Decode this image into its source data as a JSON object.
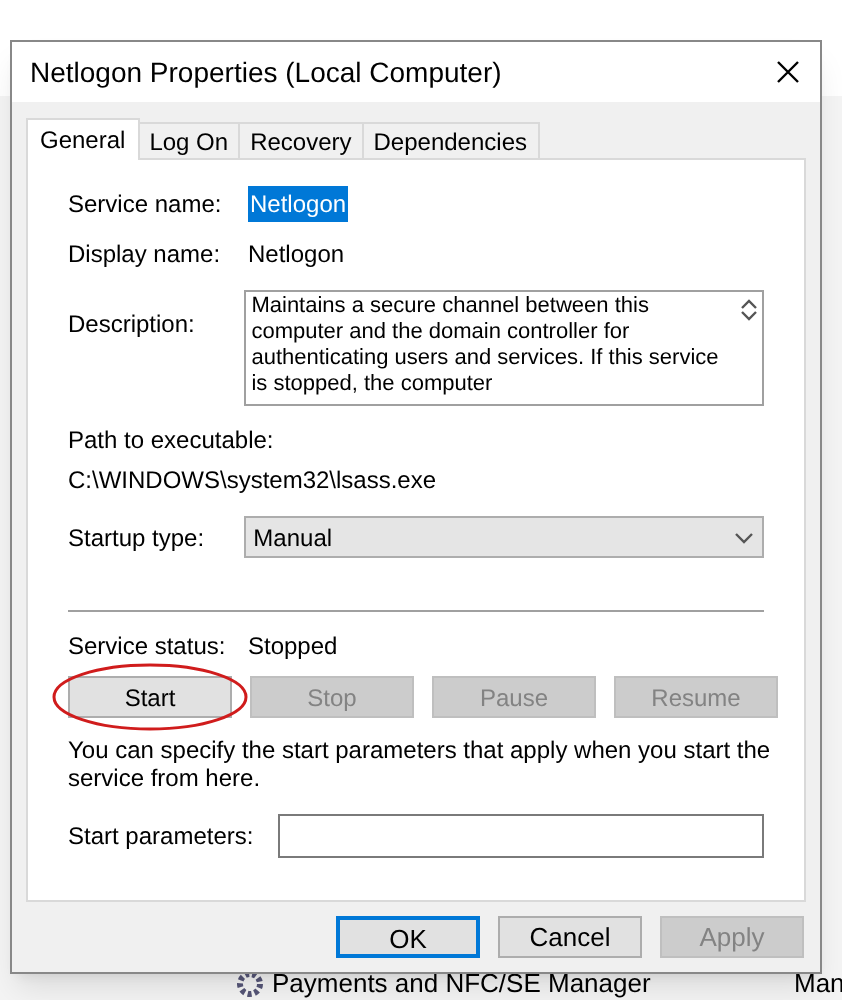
{
  "background": {
    "bottom_row": {
      "name": "Payments and NFC/SE Manager",
      "column_2": "Man"
    }
  },
  "window": {
    "title": "Netlogon Properties (Local Computer)"
  },
  "tabs": [
    {
      "label": "General",
      "selected": true
    },
    {
      "label": "Log On",
      "selected": false
    },
    {
      "label": "Recovery",
      "selected": false
    },
    {
      "label": "Dependencies",
      "selected": false
    }
  ],
  "service_name": {
    "label": "Service name:",
    "value": "Netlogon",
    "selected": true
  },
  "display_name": {
    "label": "Display name:",
    "value": "Netlogon"
  },
  "description": {
    "label": "Description:",
    "value": "Maintains a secure channel between this computer and the domain controller for authenticating users and services. If this service is stopped, the computer"
  },
  "path": {
    "label": "Path to executable:",
    "value": "C:\\WINDOWS\\system32\\lsass.exe"
  },
  "startup_type": {
    "label": "Startup type:",
    "value": "Manual"
  },
  "service_status": {
    "label": "Service status:",
    "value": "Stopped"
  },
  "service_buttons": [
    {
      "label": "Start",
      "disabled": false,
      "circled": true
    },
    {
      "label": "Stop",
      "disabled": true,
      "circled": false
    },
    {
      "label": "Pause",
      "disabled": true,
      "circled": false
    },
    {
      "label": "Resume",
      "disabled": true,
      "circled": false
    }
  ],
  "hint": "You can specify the start parameters that apply when you start the service from here.",
  "start_parameters": {
    "label": "Start parameters:"
  },
  "buttons": [
    {
      "label": "OK",
      "default": true,
      "disabled": false
    },
    {
      "label": "Cancel",
      "default": false,
      "disabled": false
    },
    {
      "label": "Apply",
      "default": false,
      "disabled": true
    }
  ]
}
